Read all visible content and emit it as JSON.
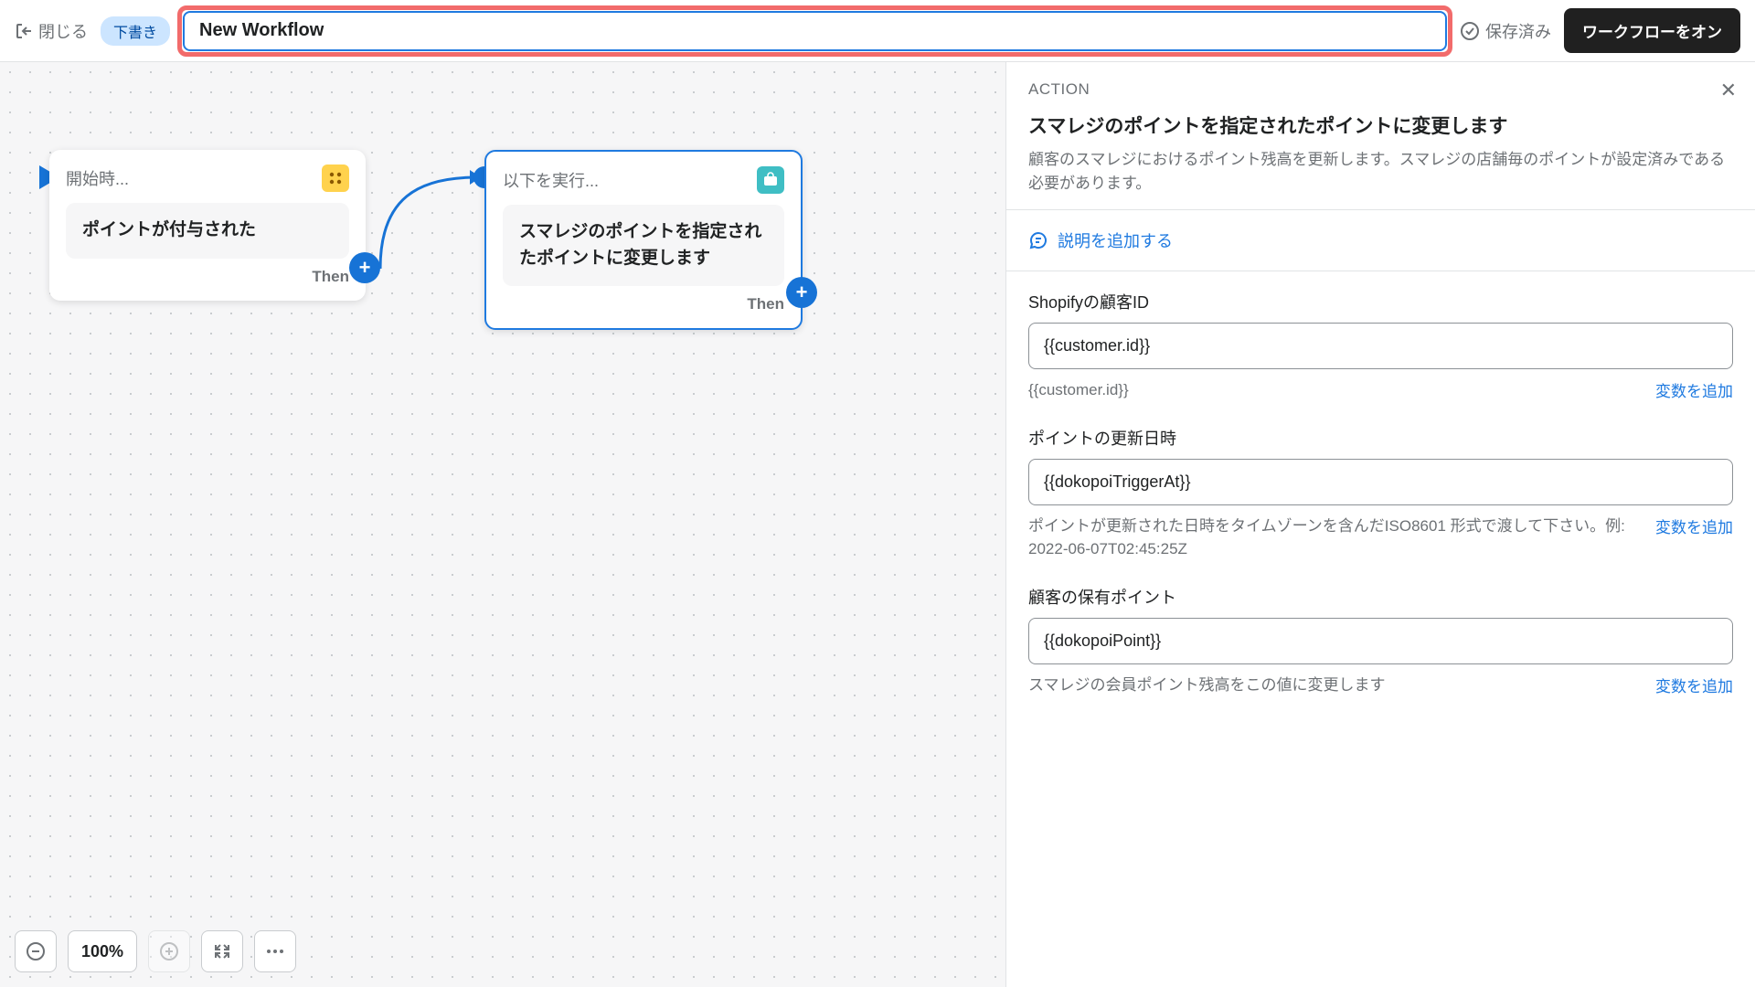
{
  "header": {
    "close_label": "閉じる",
    "draft_label": "下書き",
    "title_value": "New Workflow",
    "saved_label": "保存済み",
    "primary_btn": "ワークフローをオン"
  },
  "canvas": {
    "node_trigger": {
      "header": "開始時...",
      "body": "ポイントが付与された",
      "then": "Then"
    },
    "node_action": {
      "header": "以下を実行...",
      "body": "スマレジのポイントを指定されたポイントに変更します",
      "then": "Then"
    }
  },
  "sidebar": {
    "tag": "ACTION",
    "title": "スマレジのポイントを指定されたポイントに変更します",
    "desc": "顧客のスマレジにおけるポイント残高を更新します。スマレジの店舗毎のポイントが設定済みである必要があります。",
    "add_desc": "説明を追加する",
    "fields": [
      {
        "label": "Shopifyの顧客ID",
        "value": "{{customer.id}}",
        "help": "{{customer.id}}",
        "var_link": "変数を追加"
      },
      {
        "label": "ポイントの更新日時",
        "value": "{{dokopoiTriggerAt}}",
        "help": "ポイントが更新された日時をタイムゾーンを含んだISO8601 形式で渡して下さい。例: 2022-06-07T02:45:25Z",
        "var_link": "変数を追加"
      },
      {
        "label": "顧客の保有ポイント",
        "value": "{{dokopoiPoint}}",
        "help": "スマレジの会員ポイント残高をこの値に変更します",
        "var_link": "変数を追加"
      }
    ]
  },
  "footer": {
    "zoom": "100%"
  }
}
